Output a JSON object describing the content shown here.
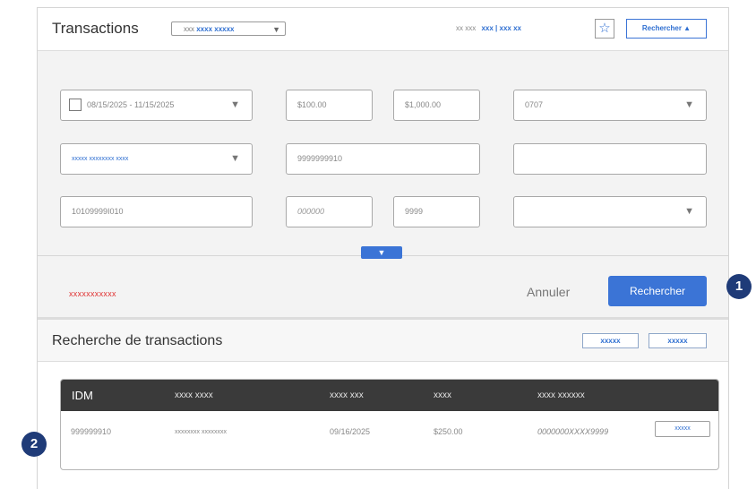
{
  "header": {
    "title": "Transactions",
    "select_prefix": "xxx",
    "select_value": "xxxx xxxxx",
    "meta_text": "xx xxx",
    "meta_link": "xxx | xxx xx",
    "search_toggle_label": "Rechercher ▲",
    "star_icon": "☆"
  },
  "filters": {
    "date_range": "08/15/2025 - 11/15/2025",
    "amount_min": "$100.00",
    "amount_max": "$1,000.00",
    "code": "0707",
    "type_select": "xxxxx xxxxxxxx xxxx",
    "reference": "9999999910",
    "field_row2_right": "",
    "account": "10109999I010",
    "small_code_1": "000000",
    "small_code_2": "9999",
    "field_row3_right": "",
    "expand_icon": "▼",
    "dropdown_icon": "▼"
  },
  "actions": {
    "error_text": "xxxxxxxxxxx",
    "cancel_label": "Annuler",
    "search_label": "Rechercher"
  },
  "results": {
    "title": "Recherche de transactions",
    "button_1": "xxxxx",
    "button_2": "xxxxx",
    "columns": [
      "IDM",
      "xxxx xxxx",
      "xxxx xxx",
      "xxxx",
      "xxxx xxxxxx"
    ],
    "rows": [
      {
        "idm": "999999910",
        "name": "xxxxxxxx xxxxxxxx",
        "date": "09/16/2025",
        "amount": "$250.00",
        "number": "0000000XXXX9999",
        "action": "xxxxx"
      }
    ]
  },
  "callouts": [
    "1",
    "2"
  ],
  "colors": {
    "accent": "#3b74d6",
    "error": "#e03131",
    "callout": "#1f3b78",
    "table_header": "#3a3a3a"
  }
}
